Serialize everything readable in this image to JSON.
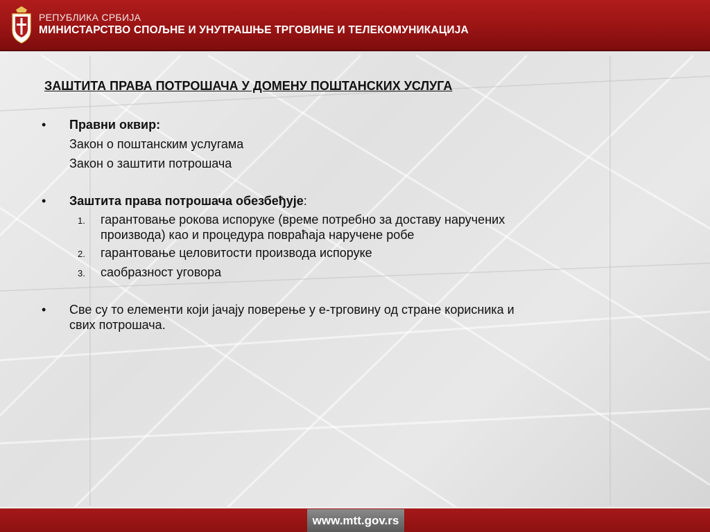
{
  "header": {
    "line1": "РЕПУБЛИКА СРБИЈА",
    "line2": "МИНИСТАРСТВО СПОЉНЕ И УНУТРАШЊЕ ТРГОВИНЕ И ТЕЛЕКОМУНИКАЦИЈА",
    "crest_icon": "serbian-coat-of-arms-icon"
  },
  "title": "ЗАШТИТА ПРАВА ПОТРОШАЧА У ДОМЕНУ ПОШТАНСКИХ УСЛУГА",
  "sections": {
    "s1": {
      "bullet": "•",
      "heading": "Правни оквир:",
      "lines": [
        "Закон о поштанским услугама",
        "Закон о заштити потрошача"
      ]
    },
    "s2": {
      "bullet": "•",
      "heading": "Заштита права потрошача обезбеђује",
      "heading_suffix": ":",
      "items": [
        {
          "num": "1.",
          "text_line1": "гарантовање рокова испоруке (време потребно за доставу наручених",
          "text_line2": "производа) као и процедура повраћаја наручене робе"
        },
        {
          "num": "2.",
          "text_line1": "гарантовање целовитости производа испоруке"
        },
        {
          "num": "3.",
          "text_line1": "саобразност уговора"
        }
      ]
    },
    "s3": {
      "bullet": "•",
      "line1": "Све су то елементи који јачају поверење у е-трговину од стране корисника и",
      "line2": "свих потрошача."
    }
  },
  "footer": {
    "url": "www.mtt.gov.rs"
  },
  "colors": {
    "header_red": "#9a1414",
    "footer_gray": "#6e6e6e",
    "text": "#111111"
  }
}
